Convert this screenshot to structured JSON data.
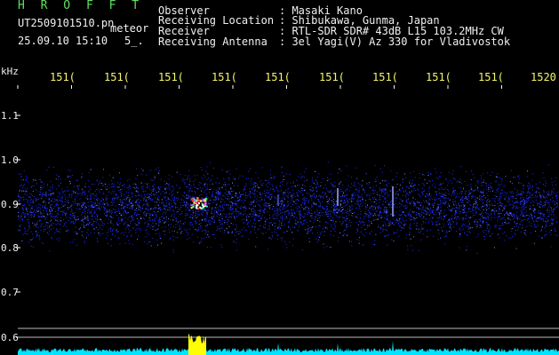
{
  "app": {
    "title": "H R O F F T"
  },
  "file": {
    "name": "UT2509101510.pn",
    "tag": "meteor",
    "date_time": "25.09.10 15:10",
    "extra": "5_."
  },
  "info": {
    "labels": [
      "Observer",
      "Receiving Location",
      "Receiver",
      "Receiving Antenna"
    ],
    "values": [
      ": Masaki Kano",
      ": Shibukawa, Gunma, Japan",
      ": RTL-SDR SDR# 43dB L15 103.2MHz CW",
      ": 3el Yagi(V) Az 330 for Vladivostok"
    ]
  },
  "axis": {
    "unit": "kHz",
    "freq_labels": [
      "151(",
      "151(",
      "151(",
      "151(",
      "151(",
      "151(",
      "151(",
      "151(",
      "151(",
      "1520"
    ],
    "y_labels": [
      "1.1",
      "1.0",
      "0.9",
      "0.8",
      "0.7",
      "0.6"
    ]
  },
  "colors": {
    "background": "#000000",
    "title": "#5fe05f",
    "text": "#f0f0f0",
    "freq": "#f5f56a",
    "noise": "#1c2cff",
    "spectrum": "#00e5ff",
    "peak": "#ffff00"
  }
}
